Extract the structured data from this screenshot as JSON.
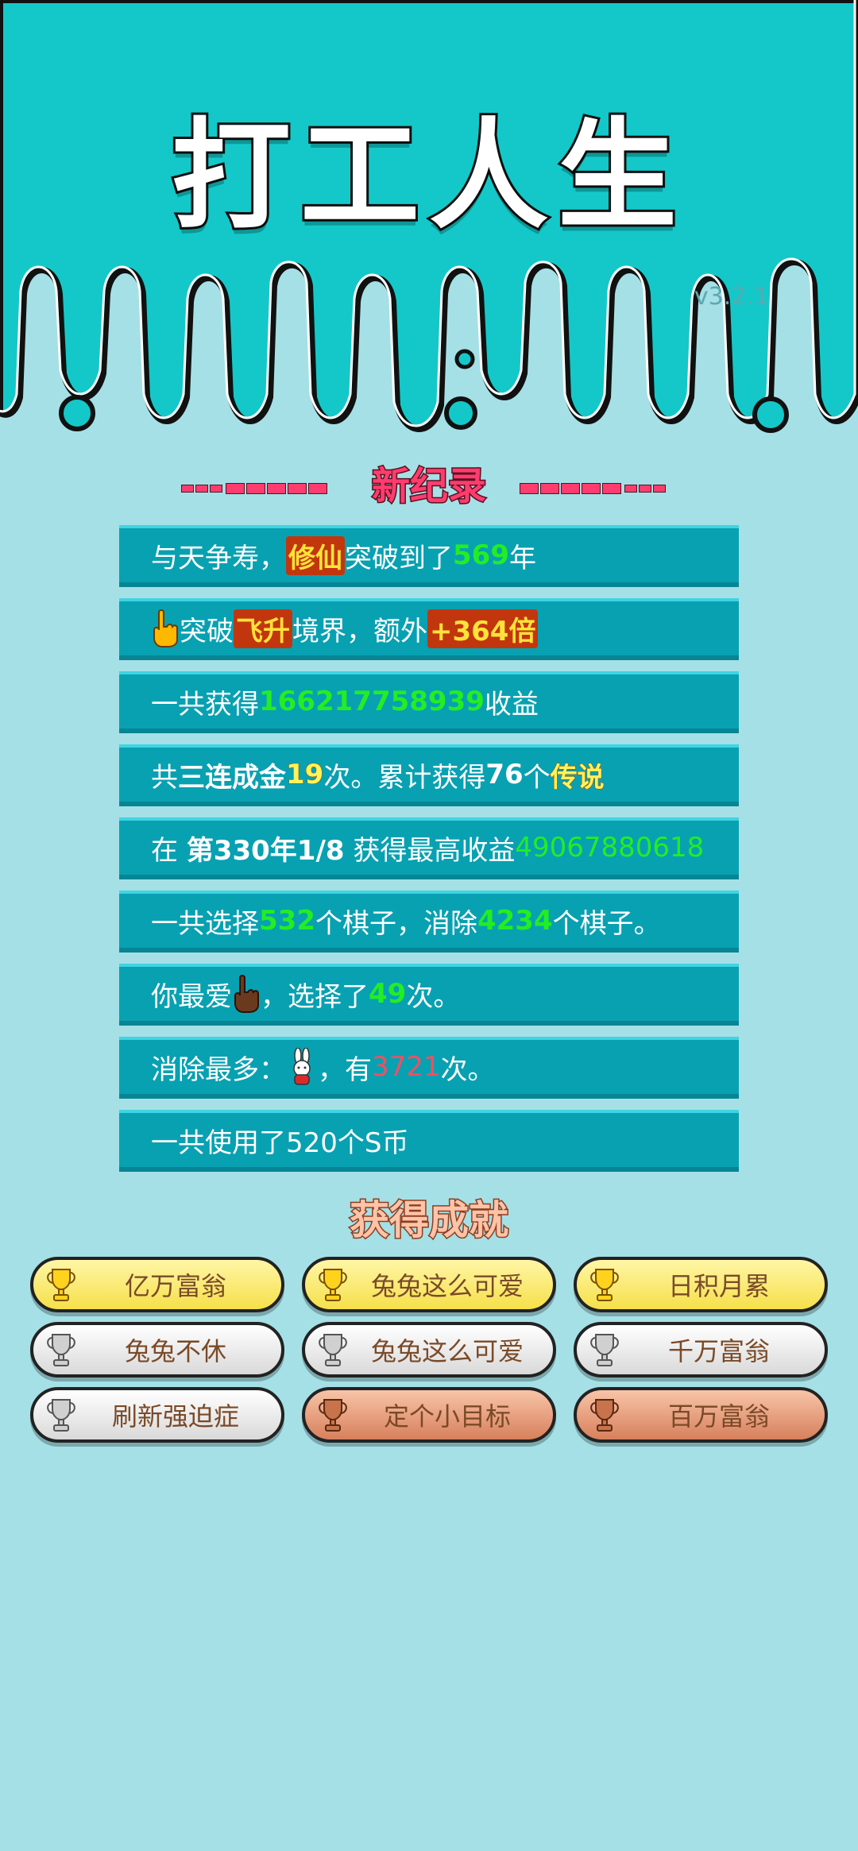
{
  "app": {
    "title": "打工人生",
    "version": "v3.2.1"
  },
  "record": {
    "title": "新纪录"
  },
  "stats": {
    "cultivation": {
      "prefix": "与天争寿，",
      "highlight": "修仙",
      "mid": "突破到了",
      "value": "569",
      "suffix": "年"
    },
    "ascension": {
      "prefix": "突破",
      "highlight": "飞升",
      "mid": "境界，额外",
      "bonus": "+364倍"
    },
    "earnings": {
      "prefix": "一共获得",
      "value": "166217758939",
      "suffix": "收益"
    },
    "combo": {
      "prefix": "共",
      "combo_label": "三连成金",
      "combo_count": "19",
      "mid": "次。累计获得",
      "legend_count": "76",
      "unit": "个",
      "legend_label": "传说"
    },
    "best": {
      "prefix": "在 ",
      "date": "第330年1/8",
      "mid": " 获得最高收益",
      "value": "49067880618"
    },
    "pieces": {
      "prefix": "一共选择",
      "selected": "532",
      "mid": "个棋子，消除",
      "removed": "4234",
      "suffix": "个棋子。"
    },
    "favorite": {
      "prefix": "你最爱",
      "mid": "，选择了",
      "count": "49",
      "suffix": "次。"
    },
    "most_removed": {
      "prefix": "消除最多：",
      "mid": "，有",
      "count": "3721",
      "suffix": "次。"
    },
    "coins": {
      "text": "一共使用了520个S币"
    }
  },
  "achievements": {
    "title": "获得成就",
    "items": [
      {
        "label": "亿万富翁",
        "tier": "gold"
      },
      {
        "label": "兔兔这么可爱",
        "tier": "gold"
      },
      {
        "label": "日积月累",
        "tier": "gold"
      },
      {
        "label": "兔兔不休",
        "tier": "silver"
      },
      {
        "label": "兔兔这么可爱",
        "tier": "silver"
      },
      {
        "label": "千万富翁",
        "tier": "silver"
      },
      {
        "label": "刷新强迫症",
        "tier": "silver"
      },
      {
        "label": "定个小目标",
        "tier": "bronze"
      },
      {
        "label": "百万富翁",
        "tier": "bronze"
      }
    ]
  },
  "colors": {
    "header_bg": "#14c8c9",
    "page_bg": "#a5e0e6",
    "row_bg": "#08a1b2",
    "highlight_green": "#22ee22",
    "highlight_yellow": "#fff35a",
    "record_pink": "#ff3c6e"
  },
  "icons": {
    "pointer": "pointing-hand-icon",
    "rabbit": "rabbit-icon",
    "trophy": "trophy-icon"
  }
}
